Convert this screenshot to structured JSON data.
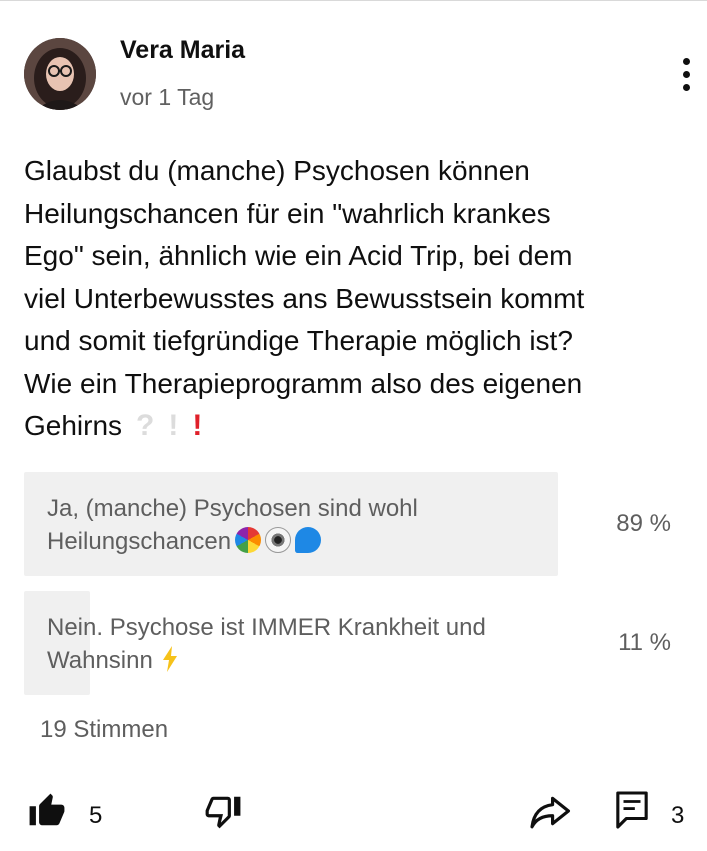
{
  "post": {
    "author": "Vera Maria",
    "time": "vor 1 Tag",
    "text": "Glaubst du (manche) Psychosen können\nHeilungschancen für ein \"wahrlich krankes\nEgo\" sein, ähnlich wie ein Acid Trip, bei dem\nviel Unterbewusstes ans Bewusstsein kommt\nund somit tiefgründige Therapie möglich ist?\nWie ein Therapieprogramm also des eigenen\nGehirns",
    "trailing_glyphs": [
      "?",
      "!",
      "!"
    ]
  },
  "poll": {
    "options": [
      {
        "text": "Ja, (manche) Psychosen sind wohl\nHeilungschancen",
        "percent_label": "89 %",
        "share": 0.89,
        "emoji": [
          "rainbow-icon",
          "eye-icon",
          "speech-bubble-icon"
        ]
      },
      {
        "text": "Nein. Psychose ist IMMER Krankheit und\nWahnsinn",
        "percent_label": "11 %",
        "share": 0.11,
        "emoji": [
          "lightning-icon"
        ]
      }
    ],
    "votes": "19 Stimmen"
  },
  "actions": {
    "likes": "5",
    "comments": "3",
    "like_icon": "thumbs-up-icon",
    "dislike_icon": "thumbs-down-icon",
    "share_icon": "share-icon",
    "comment_icon": "comment-icon",
    "menu_icon": "more-vertical-icon"
  },
  "colors": {
    "poll_fill": "#f0f0f0",
    "secondary_text": "#5e5e5e",
    "alert_red": "#e0202a"
  }
}
